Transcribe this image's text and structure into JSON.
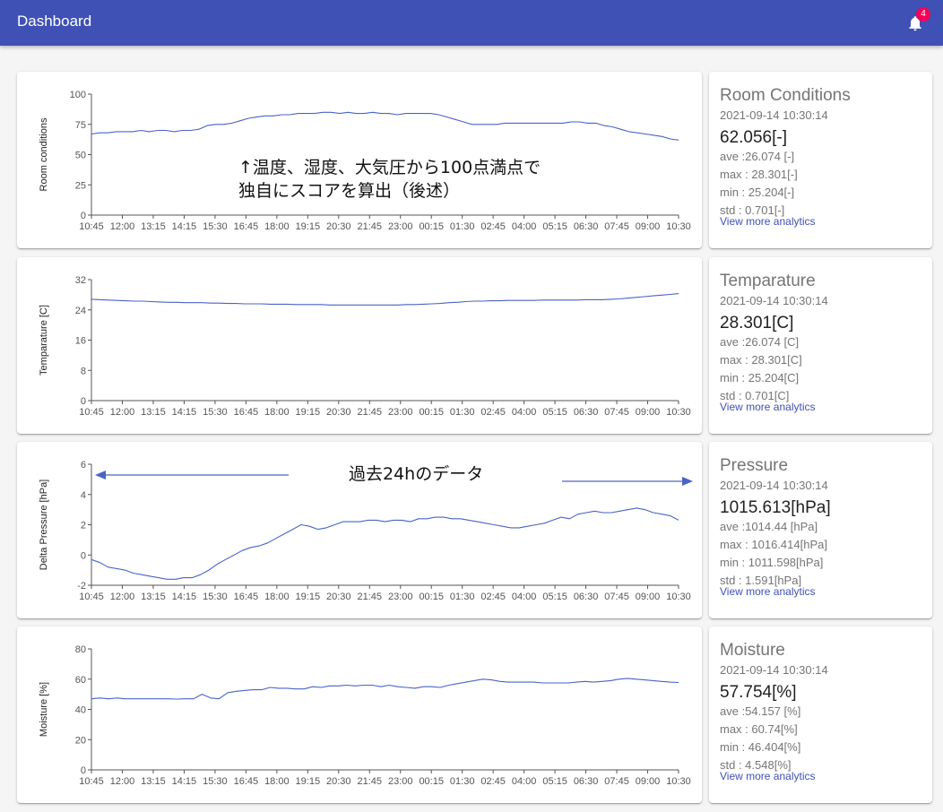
{
  "app": {
    "title": "Dashboard",
    "notification_count": "4"
  },
  "panels": [
    {
      "stat": {
        "title": "Room Conditions",
        "timestamp": "2021-09-14 10:30:14",
        "current": "62.056[-]",
        "ave": "ave :26.074 [-]",
        "max": "max : 28.301[-]",
        "min": "min : 25.204[-]",
        "std": "std : 0.701[-]",
        "link": "View more analytics"
      }
    },
    {
      "stat": {
        "title": "Temparature",
        "timestamp": "2021-09-14 10:30:14",
        "current": "28.301[C]",
        "ave": "ave :26.074 [C]",
        "max": "max : 28.301[C]",
        "min": "min : 25.204[C]",
        "std": "std : 0.701[C]",
        "link": "View more analytics"
      }
    },
    {
      "stat": {
        "title": "Pressure",
        "timestamp": "2021-09-14 10:30:14",
        "current": "1015.613[hPa]",
        "ave": "ave :1014.44 [hPa]",
        "max": "max : 1016.414[hPa]",
        "min": "min : 1011.598[hPa]",
        "std": "std : 1.591[hPa]",
        "link": "View more analytics"
      }
    },
    {
      "stat": {
        "title": "Moisture",
        "timestamp": "2021-09-14 10:30:14",
        "current": "57.754[%]",
        "ave": "ave :54.157 [%]",
        "max": "max : 60.74[%]",
        "min": "min : 46.404[%]",
        "std": "std : 4.548[%]",
        "link": "View more analytics"
      }
    }
  ],
  "annotations": {
    "score_note": "↑温度、湿度、大気圧から100点満点で\n独自にスコアを算出（後述）",
    "range_note": "過去24hのデータ"
  },
  "chart_data": [
    {
      "type": "line",
      "ylabel": "Room conditions",
      "ylim": [
        0,
        100
      ],
      "yticks": [
        "0",
        "25",
        "50",
        "75",
        "100"
      ],
      "xticks": [
        "10:45",
        "12:00",
        "13:15",
        "14:15",
        "15:30",
        "16:45",
        "18:00",
        "19:15",
        "20:30",
        "21:45",
        "23:00",
        "00:15",
        "01:30",
        "02:45",
        "04:00",
        "05:15",
        "06:30",
        "07:45",
        "09:00",
        "10:30"
      ],
      "color": "#4a63c6",
      "series": [
        {
          "values": [
            67,
            68,
            68,
            69,
            69,
            69,
            70,
            69,
            70,
            70,
            69,
            70,
            70,
            71,
            74,
            75,
            75,
            76,
            78,
            80,
            81,
            82,
            82,
            83,
            83,
            84,
            84,
            84,
            85,
            85,
            84,
            85,
            84,
            84,
            85,
            84,
            84,
            83,
            84,
            84,
            84,
            84,
            83,
            81,
            79,
            77,
            75,
            75,
            75,
            75,
            76,
            76,
            76,
            76,
            76,
            76,
            76,
            76,
            77,
            77,
            76,
            76,
            74,
            73,
            71,
            69,
            68,
            67,
            66,
            65,
            63,
            62
          ]
        }
      ]
    },
    {
      "type": "line",
      "ylabel": "Temparature [C]",
      "ylim": [
        0,
        32
      ],
      "yticks": [
        "0",
        "8",
        "16",
        "24",
        "32"
      ],
      "xticks": [
        "10:45",
        "12:00",
        "13:15",
        "14:15",
        "15:30",
        "16:45",
        "18:00",
        "19:15",
        "20:30",
        "21:45",
        "23:00",
        "00:15",
        "01:30",
        "02:45",
        "04:00",
        "05:15",
        "06:30",
        "07:45",
        "09:00",
        "10:30"
      ],
      "color": "#4a63c6",
      "series": [
        {
          "values": [
            26.8,
            26.7,
            26.6,
            26.5,
            26.4,
            26.3,
            26.3,
            26.2,
            26.1,
            26.0,
            26.0,
            25.9,
            25.9,
            25.9,
            25.8,
            25.8,
            25.7,
            25.7,
            25.6,
            25.6,
            25.6,
            25.5,
            25.5,
            25.5,
            25.4,
            25.4,
            25.4,
            25.4,
            25.3,
            25.3,
            25.3,
            25.3,
            25.3,
            25.3,
            25.3,
            25.3,
            25.3,
            25.4,
            25.4,
            25.5,
            25.6,
            25.7,
            25.9,
            26.0,
            26.2,
            26.3,
            26.3,
            26.4,
            26.4,
            26.5,
            26.5,
            26.5,
            26.5,
            26.6,
            26.6,
            26.6,
            26.6,
            26.6,
            26.7,
            26.7,
            26.7,
            26.8,
            26.9,
            27.1,
            27.3,
            27.5,
            27.7,
            27.9,
            28.1,
            28.3
          ]
        }
      ]
    },
    {
      "type": "line",
      "ylabel": "Delta Pressure [hPa]",
      "ylim": [
        -2,
        6
      ],
      "yticks": [
        "-2",
        "0",
        "2",
        "4",
        "6"
      ],
      "xticks": [
        "10:45",
        "12:00",
        "13:15",
        "14:15",
        "15:30",
        "16:45",
        "18:00",
        "19:15",
        "20:30",
        "21:45",
        "23:00",
        "00:15",
        "01:30",
        "02:45",
        "04:00",
        "05:15",
        "06:30",
        "07:45",
        "09:00",
        "10:30"
      ],
      "color": "#4a63c6",
      "series": [
        {
          "values": [
            -0.3,
            -0.5,
            -0.8,
            -0.9,
            -1.0,
            -1.2,
            -1.3,
            -1.4,
            -1.5,
            -1.6,
            -1.6,
            -1.5,
            -1.5,
            -1.3,
            -1.0,
            -0.6,
            -0.3,
            0.0,
            0.3,
            0.5,
            0.6,
            0.8,
            1.1,
            1.4,
            1.7,
            2.0,
            1.9,
            1.7,
            1.8,
            2.0,
            2.2,
            2.2,
            2.2,
            2.3,
            2.3,
            2.2,
            2.3,
            2.3,
            2.2,
            2.4,
            2.4,
            2.5,
            2.5,
            2.4,
            2.4,
            2.3,
            2.2,
            2.1,
            2.0,
            1.9,
            1.8,
            1.8,
            1.9,
            2.0,
            2.1,
            2.3,
            2.5,
            2.4,
            2.7,
            2.8,
            2.9,
            2.8,
            2.8,
            2.9,
            3.0,
            3.1,
            3.0,
            2.8,
            2.7,
            2.6,
            2.3
          ]
        }
      ]
    },
    {
      "type": "line",
      "ylabel": "Moisture [%]",
      "ylim": [
        0,
        80
      ],
      "yticks": [
        "0",
        "20",
        "40",
        "60",
        "80"
      ],
      "xticks": [
        "10:45",
        "12:00",
        "13:15",
        "14:15",
        "15:30",
        "16:45",
        "18:00",
        "19:15",
        "20:30",
        "21:45",
        "23:00",
        "00:15",
        "01:30",
        "02:45",
        "04:00",
        "05:15",
        "06:30",
        "07:45",
        "09:00",
        "10:30"
      ],
      "color": "#4a63c6",
      "series": [
        {
          "values": [
            47,
            47.5,
            47,
            47.5,
            47,
            47,
            47,
            47,
            47,
            47,
            46.8,
            47,
            47,
            50,
            47.5,
            47,
            51,
            52,
            52.5,
            53,
            53,
            54.5,
            54,
            54,
            53.5,
            53.5,
            55,
            54.5,
            55.5,
            55.5,
            56,
            55.5,
            56,
            56,
            55,
            56,
            55,
            54.5,
            54,
            55,
            55,
            54.5,
            56,
            57,
            58,
            59,
            60,
            59.5,
            58.5,
            58,
            58,
            58,
            58,
            57.5,
            57.5,
            57.5,
            57.5,
            58,
            58.5,
            58,
            58.5,
            59,
            60,
            60.5,
            60,
            59.5,
            59,
            58.5,
            58,
            57.75
          ]
        }
      ]
    }
  ]
}
